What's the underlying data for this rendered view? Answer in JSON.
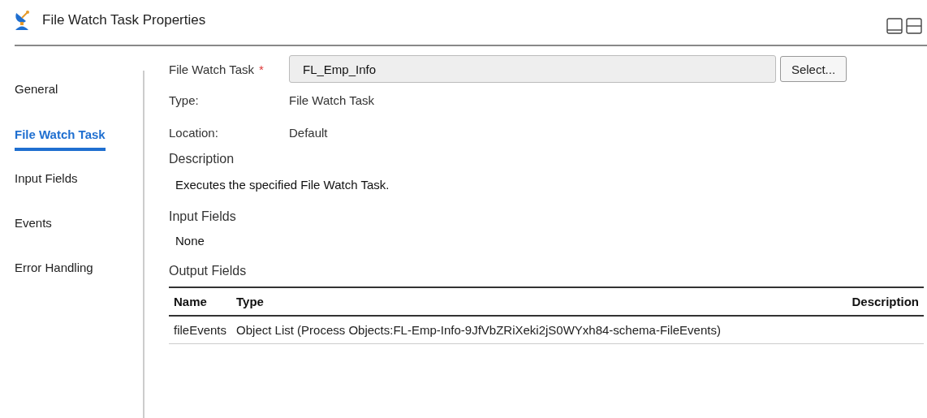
{
  "window": {
    "title": "File Watch Task Properties"
  },
  "sidebar": {
    "items": [
      {
        "label": "General",
        "selected": false
      },
      {
        "label": "File Watch Task",
        "selected": true
      },
      {
        "label": "Input Fields",
        "selected": false
      },
      {
        "label": "Events",
        "selected": false
      },
      {
        "label": "Error Handling",
        "selected": false
      }
    ]
  },
  "task_field": {
    "label": "File Watch Task",
    "required_mark": "*",
    "value": "FL_Emp_Info",
    "button": "Select..."
  },
  "info": [
    {
      "label": "Type:",
      "value": "File Watch Task"
    },
    {
      "label": "Location:",
      "value": "Default"
    }
  ],
  "description": {
    "heading": "Description",
    "text": "Executes the specified File Watch Task."
  },
  "input_fields": {
    "heading": "Input Fields",
    "text": "None"
  },
  "output_fields": {
    "heading": "Output Fields",
    "columns": [
      "Name",
      "Type",
      "Description"
    ],
    "rows": [
      [
        "fileEvents",
        "Object List (Process Objects:FL-Emp-Info-9JfVbZRiXeki2jS0WYxh84-schema-FileEvents)",
        ""
      ]
    ]
  }
}
